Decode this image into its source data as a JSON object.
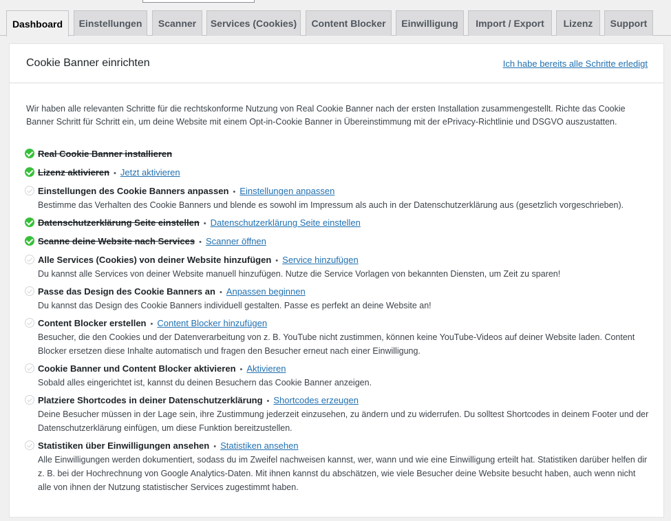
{
  "tabs": [
    {
      "label": "Dashboard",
      "active": true
    },
    {
      "label": "Einstellungen"
    },
    {
      "label": "Scanner"
    },
    {
      "label": "Services (Cookies)"
    },
    {
      "label": "Content Blocker"
    },
    {
      "label": "Einwilligung"
    },
    {
      "label": "Import / Export"
    },
    {
      "label": "Lizenz"
    },
    {
      "label": "Support"
    }
  ],
  "panel": {
    "title": "Cookie Banner einrichten",
    "skip_link": "Ich habe bereits alle Schritte erledigt",
    "intro": "Wir haben alle relevanten Schritte für die rechtskonforme Nutzung von Real Cookie Banner nach der ersten Installation zusammengestellt. Richte das Cookie Banner Schritt für Schritt ein, um deine Website mit einem Opt-in-Cookie Banner in Übereinstimmung mit der ePrivacy-Richtlinie und DSGVO auszustatten."
  },
  "steps": [
    {
      "title": "Real Cookie Banner installieren",
      "done": true
    },
    {
      "title": "Lizenz aktivieren",
      "done": true,
      "link": "Jetzt aktivieren"
    },
    {
      "title": "Einstellungen des Cookie Banners anpassen",
      "done": false,
      "link": "Einstellungen anpassen",
      "desc": "Bestimme das Verhalten des Cookie Banners und blende es sowohl im Impressum als auch in der Datenschutzerklärung aus (gesetzlich vorgeschrieben)."
    },
    {
      "title": "Datenschutzerklärung Seite einstellen",
      "done": true,
      "link": "Datenschutzerklärung Seite einstellen"
    },
    {
      "title": "Scanne deine Website nach Services",
      "done": true,
      "link": "Scanner öffnen"
    },
    {
      "title": "Alle Services (Cookies) von deiner Website hinzufügen",
      "done": false,
      "link": "Service hinzufügen",
      "desc": "Du kannst alle Services von deiner Website manuell hinzufügen. Nutze die Service Vorlagen von bekannten Diensten, um Zeit zu sparen!"
    },
    {
      "title": "Passe das Design des Cookie Banners an",
      "done": false,
      "link": "Anpassen beginnen",
      "desc": "Du kannst das Design des Cookie Banners individuell gestalten. Passe es perfekt an deine Website an!"
    },
    {
      "title": "Content Blocker erstellen",
      "done": false,
      "link": "Content Blocker hinzufügen",
      "desc": "Besucher, die den Cookies und der Datenverarbeitung von z. B. YouTube nicht zustimmen, können keine YouTube-Videos auf deiner Website laden. Content Blocker ersetzen diese Inhalte automatisch und fragen den Besucher erneut nach einer Einwilligung."
    },
    {
      "title": "Cookie Banner und Content Blocker aktivieren",
      "done": false,
      "link": "Aktivieren",
      "desc": "Sobald alles eingerichtet ist, kannst du deinen Besuchern das Cookie Banner anzeigen."
    },
    {
      "title": "Platziere Shortcodes in deiner Datenschutzerklärung",
      "done": false,
      "link": "Shortcodes erzeugen",
      "desc": "Deine Besucher müssen in der Lage sein, ihre Zustimmung jederzeit einzusehen, zu ändern und zu widerrufen. Du solltest Shortcodes in deinem Footer und der Datenschutzerklärung einfügen, um diese Funktion bereitzustellen."
    },
    {
      "title": "Statistiken über Einwilligungen ansehen",
      "done": false,
      "link": "Statistiken ansehen",
      "desc": "Alle Einwilligungen werden dokumentiert, sodass du im Zweifel nachweisen kannst, wer, wann und wie eine Einwilligung erteilt hat. Statistiken darüber helfen dir z. B. bei der Hochrechnung von Google Analytics-Daten. Mit ihnen kannst du abschätzen, wie viele Besucher deine Website besucht haben, auch wenn nicht alle von ihnen der Nutzung statistischer Services zugestimmt haben."
    }
  ],
  "separator": "•",
  "colors": {
    "check": "#38c03a",
    "link": "#2271b1",
    "tab_bg": "#dcdcde"
  }
}
